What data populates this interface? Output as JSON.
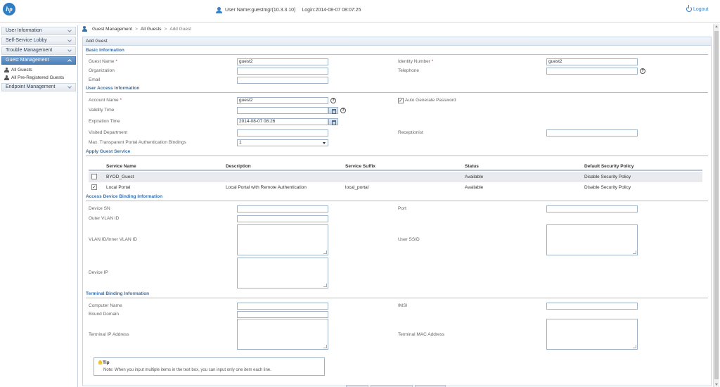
{
  "header": {
    "logo": "hp",
    "user_text": "User Name:guestmgr(10.3.3.10)",
    "login_text": "Login:2014-08-07 08:07:25",
    "logout_label": "Logout"
  },
  "sidebar": {
    "items": [
      {
        "label": "User Information"
      },
      {
        "label": "Self-Service Lobby"
      },
      {
        "label": "Trouble Management"
      },
      {
        "label": "Guest Management"
      },
      {
        "label": "Endpoint Management"
      }
    ],
    "sub_items": [
      {
        "label": "All Guests"
      },
      {
        "label": "All Pre-Registered Guests"
      }
    ]
  },
  "breadcrumb": {
    "part1": "Guest Management",
    "sep": ">",
    "part2": "All Guests",
    "part3": "Add Guest"
  },
  "panel": {
    "title": "Add Guest"
  },
  "basic": {
    "heading": "Basic Information",
    "guest_name_label": "Guest Name",
    "guest_name_value": "guest2",
    "identity_label": "Identity Number",
    "identity_value": "guest2",
    "organization_label": "Organization",
    "telephone_label": "Telephone",
    "email_label": "Email"
  },
  "access": {
    "heading": "User Access Information",
    "account_label": "Account Name",
    "account_value": "guest2",
    "auto_pwd_label": "Auto Generate Password",
    "validity_label": "Validity Time",
    "expiration_label": "Expiration Time",
    "expiration_value": "2014-08-07 08:26",
    "visited_label": "Visited Department",
    "receptionist_label": "Receptionist",
    "max_portal_label": "Max. Transparent Portal Authentication Bindings",
    "max_portal_value": "1"
  },
  "service": {
    "heading": "Apply Guest Service",
    "columns": [
      "Service Name",
      "Description",
      "Service Suffix",
      "Status",
      "Default Security Policy"
    ],
    "rows": [
      {
        "checked": false,
        "name": "BYOD_Guest",
        "description": "",
        "suffix": "",
        "status": "Available",
        "policy": "Disable Security Policy"
      },
      {
        "checked": true,
        "name": "Local Portal",
        "description": "Local Portal with Remote Authentication",
        "suffix": "local_portal",
        "status": "Available",
        "policy": "Disable Security Policy"
      }
    ]
  },
  "device": {
    "heading": "Access Device Binding Information",
    "device_sn_label": "Device SN",
    "port_label": "Port",
    "outer_vlan_label": "Outer VLAN ID",
    "vlan_label": "VLAN ID/Inner VLAN ID",
    "ssid_label": "User SSID",
    "device_ip_label": "Device IP"
  },
  "terminal": {
    "heading": "Terminal Binding Information",
    "computer_label": "Computer Name",
    "imsi_label": "IMSI",
    "domain_label": "Bound Domain",
    "ip_label": "Terminal IP Address",
    "mac_label": "Terminal MAC Address"
  },
  "tip": {
    "title": "Tip",
    "text": "Note: When you input multiple items in the text box, you can input only one item each line."
  },
  "required_mark": "*",
  "help_glyph": "?"
}
